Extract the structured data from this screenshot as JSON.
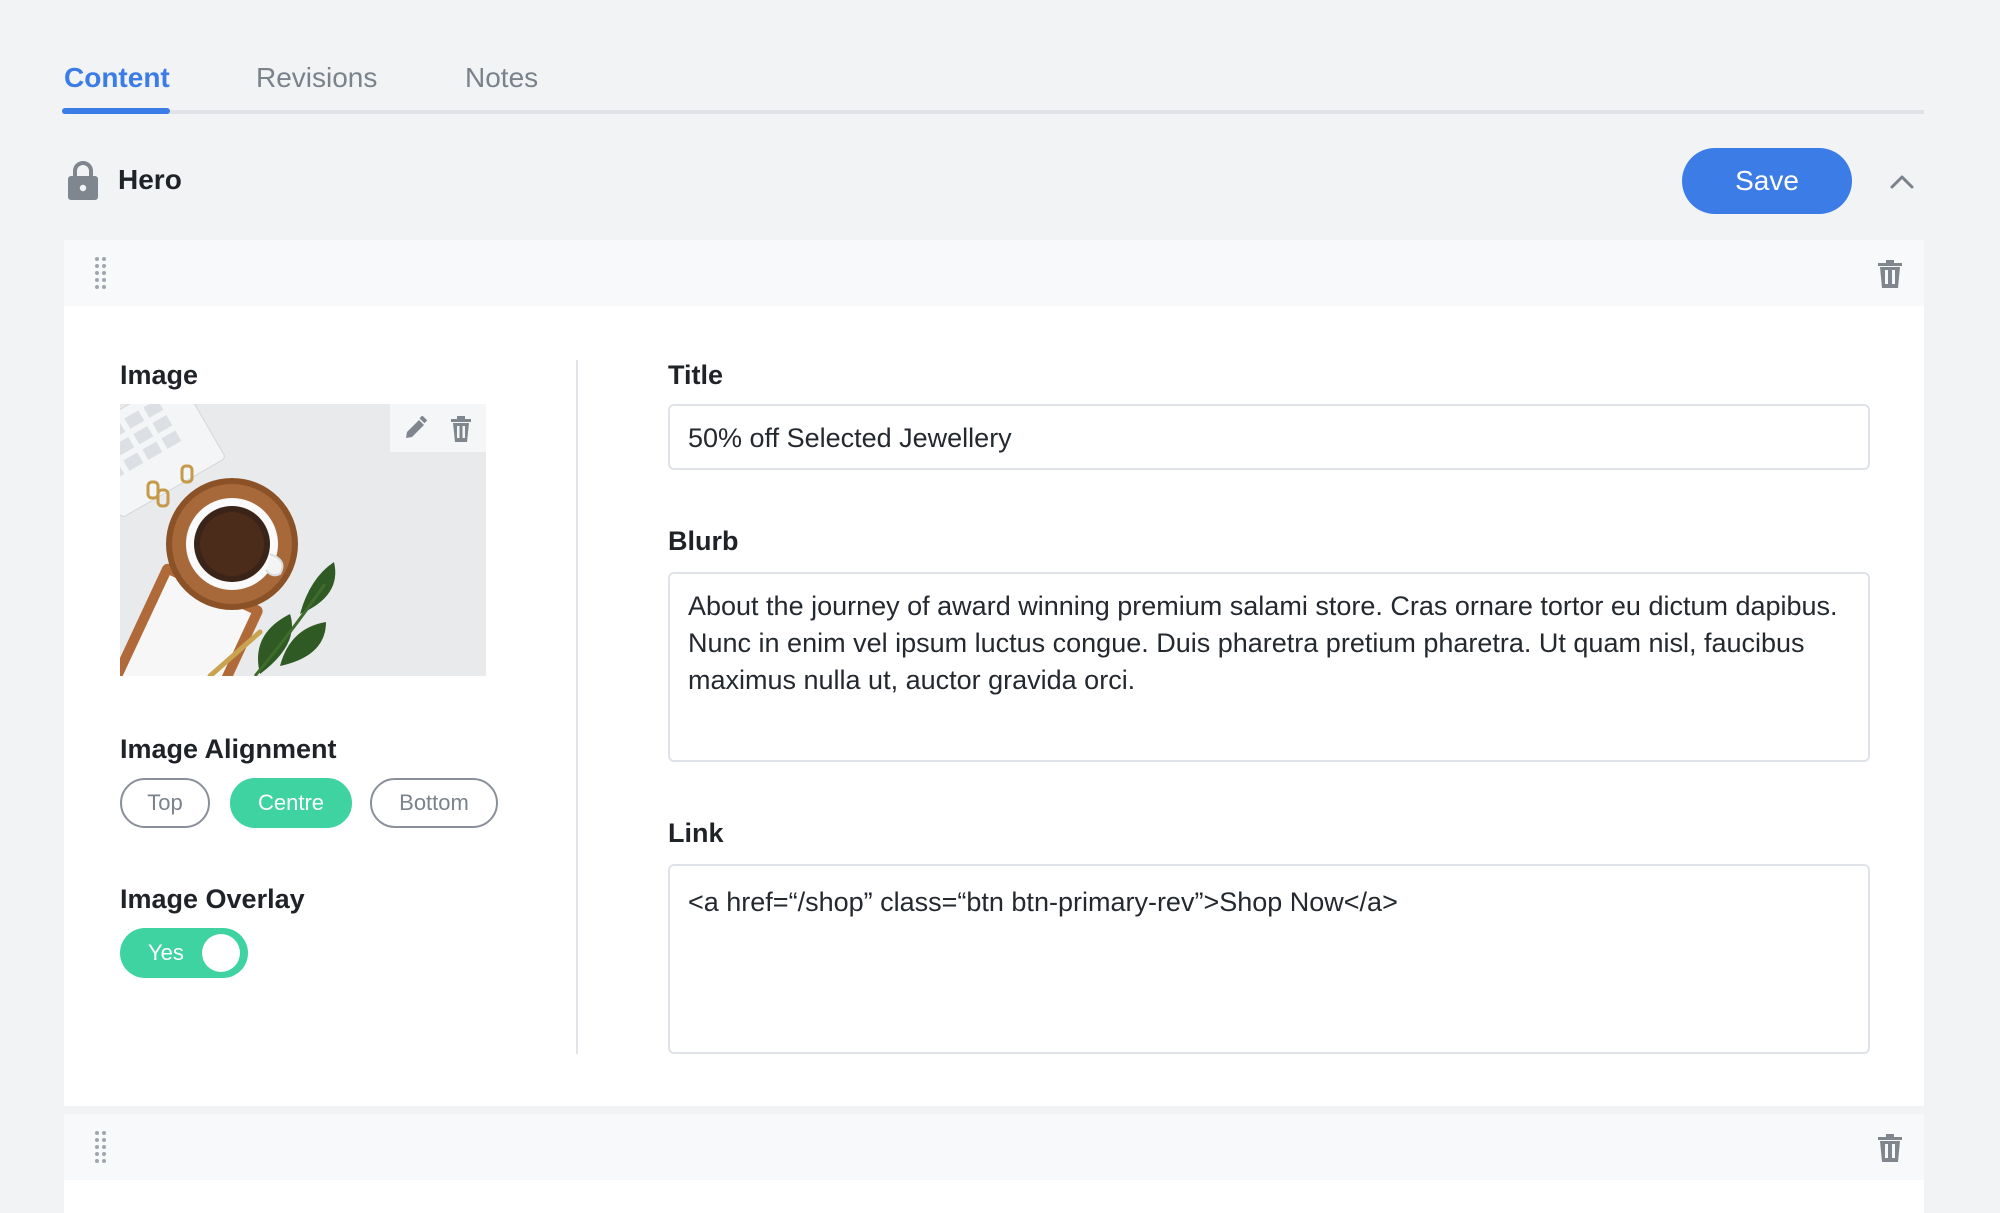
{
  "tabs": [
    {
      "label": "Content",
      "active": true
    },
    {
      "label": "Revisions",
      "active": false
    },
    {
      "label": "Notes",
      "active": false
    }
  ],
  "header": {
    "title": "Hero",
    "save_label": "Save",
    "icons": [
      "lock-icon",
      "chevron-up-icon"
    ]
  },
  "block": {
    "icons": [
      "drag-handle-icon",
      "trash-icon"
    ],
    "image": {
      "label": "Image",
      "description_icons": [
        "pencil-icon",
        "trash-icon"
      ]
    },
    "alignment": {
      "label": "Image Alignment",
      "options": [
        "Top",
        "Centre",
        "Bottom"
      ],
      "selected": "Centre"
    },
    "overlay": {
      "label": "Image Overlay",
      "value_label": "Yes",
      "on": true
    },
    "title": {
      "label": "Title",
      "value": "50% off Selected Jewellery"
    },
    "blurb": {
      "label": "Blurb",
      "value": "About the journey of award winning premium salami store. Cras ornare tortor eu dictum dapibus. Nunc in enim vel ipsum luctus congue. Duis pharetra pretium pharetra. Ut quam nisl, faucibus maximus nulla ut, auctor gravida orci."
    },
    "link": {
      "label": "Link",
      "value": "<a href=“/shop” class=“btn btn-primary-rev”>Shop Now</a>"
    }
  },
  "colors": {
    "accent": "#3b7ce6",
    "toggle_green": "#3ed3a0",
    "background": "#f2f3f5"
  }
}
